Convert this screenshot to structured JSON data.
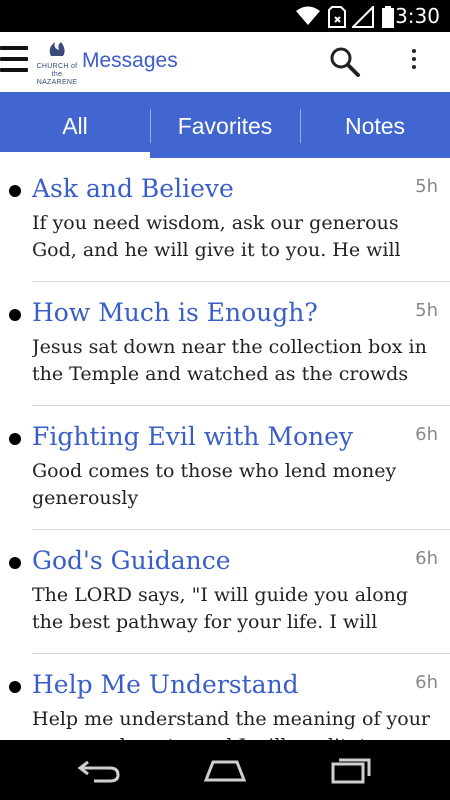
{
  "status_bar": {
    "time": "3:30",
    "icons": [
      "wifi-icon",
      "sim-no-signal-icon",
      "signal-icon",
      "battery-icon"
    ]
  },
  "app_bar": {
    "title": "Messages",
    "logo": {
      "line1": "CHURCH of the",
      "line2": "NAZARENE"
    },
    "icons": [
      "menu-icon",
      "search-icon",
      "overflow-menu-icon"
    ]
  },
  "tabs": [
    {
      "label": "All",
      "selected": true
    },
    {
      "label": "Favorites",
      "selected": false
    },
    {
      "label": "Notes",
      "selected": false
    }
  ],
  "messages": [
    {
      "title": "Ask and Believe",
      "time": "5h",
      "snippet": "If you need wisdom, ask our generous God, and he will give it to you. He will not"
    },
    {
      "title": "How Much is Enough?",
      "time": "5h",
      "snippet": "Jesus sat down near the collection box in the Temple and watched as the crowds"
    },
    {
      "title": "Fighting Evil with Money",
      "time": "6h",
      "snippet": "Good comes to those who lend money generously"
    },
    {
      "title": "God's Guidance",
      "time": "6h",
      "snippet": "The LORD says, \"I will guide you along the best pathway for your life. I will advise"
    },
    {
      "title": "Help Me Understand",
      "time": "6h",
      "snippet": "Help me understand the meaning of your commandments, and I will meditate"
    }
  ],
  "nav_bar": {
    "icons": [
      "back-icon",
      "home-icon",
      "recent-apps-icon"
    ]
  },
  "colors": {
    "accent": "#4166cf",
    "title_text": "#3a5ec7",
    "status_bar": "#000000"
  }
}
